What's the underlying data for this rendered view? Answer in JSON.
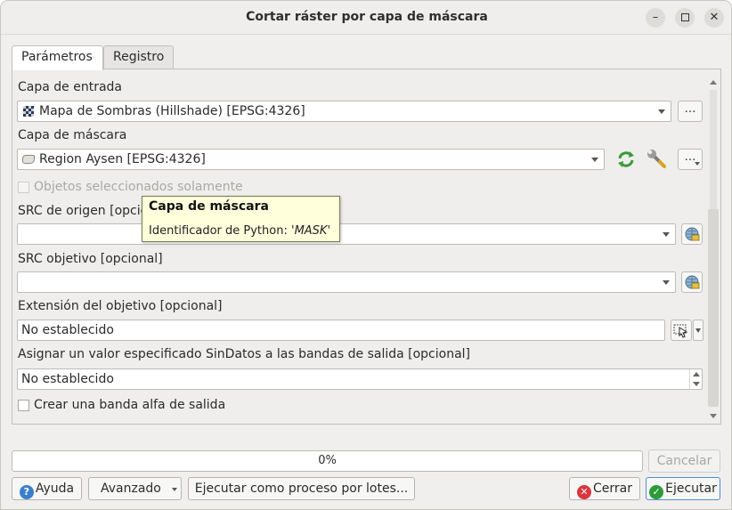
{
  "window": {
    "title": "Cortar ráster por capa de máscara"
  },
  "tabs": [
    {
      "label": "Parámetros"
    },
    {
      "label": "Registro"
    }
  ],
  "params": {
    "input_layer": {
      "label": "Capa de entrada",
      "value": "Mapa de Sombras (Hillshade) [EPSG:4326]"
    },
    "mask_layer": {
      "label": "Capa de máscara",
      "value": "Region Aysen [EPSG:4326]"
    },
    "selected_only": {
      "label": "Objetos seleccionados solamente"
    },
    "source_crs": {
      "label": "SRC de origen [opcional]",
      "value": ""
    },
    "target_crs": {
      "label": "SRC objetivo [opcional]",
      "value": ""
    },
    "target_extent": {
      "label": "Extensión del objetivo [opcional]",
      "value": "No establecido"
    },
    "nodata": {
      "label": "Asignar un valor especificado SinDatos a las bandas de salida [opcional]",
      "value": "No establecido"
    },
    "alpha_band": {
      "label": "Crear una banda alfa de salida"
    },
    "dots": "…"
  },
  "tooltip": {
    "title": "Capa de máscara",
    "body_prefix": "Identificador de Python: '",
    "body_name": "MASK",
    "body_suffix": "'"
  },
  "progress": {
    "value": 0,
    "text": "0%"
  },
  "buttons": {
    "cancel": "Cancelar",
    "help": "Ayuda",
    "advanced": "Avanzado",
    "batch": "Ejecutar como proceso por lotes...",
    "close": "Cerrar",
    "run": "Ejecutar"
  },
  "colors": {
    "accent": "#4c8fd6",
    "tooltip_bg": "#ffffdc",
    "run_icon": "#2e9a3a",
    "close_icon": "#d9363e",
    "help_icon": "#3b7fcc"
  }
}
